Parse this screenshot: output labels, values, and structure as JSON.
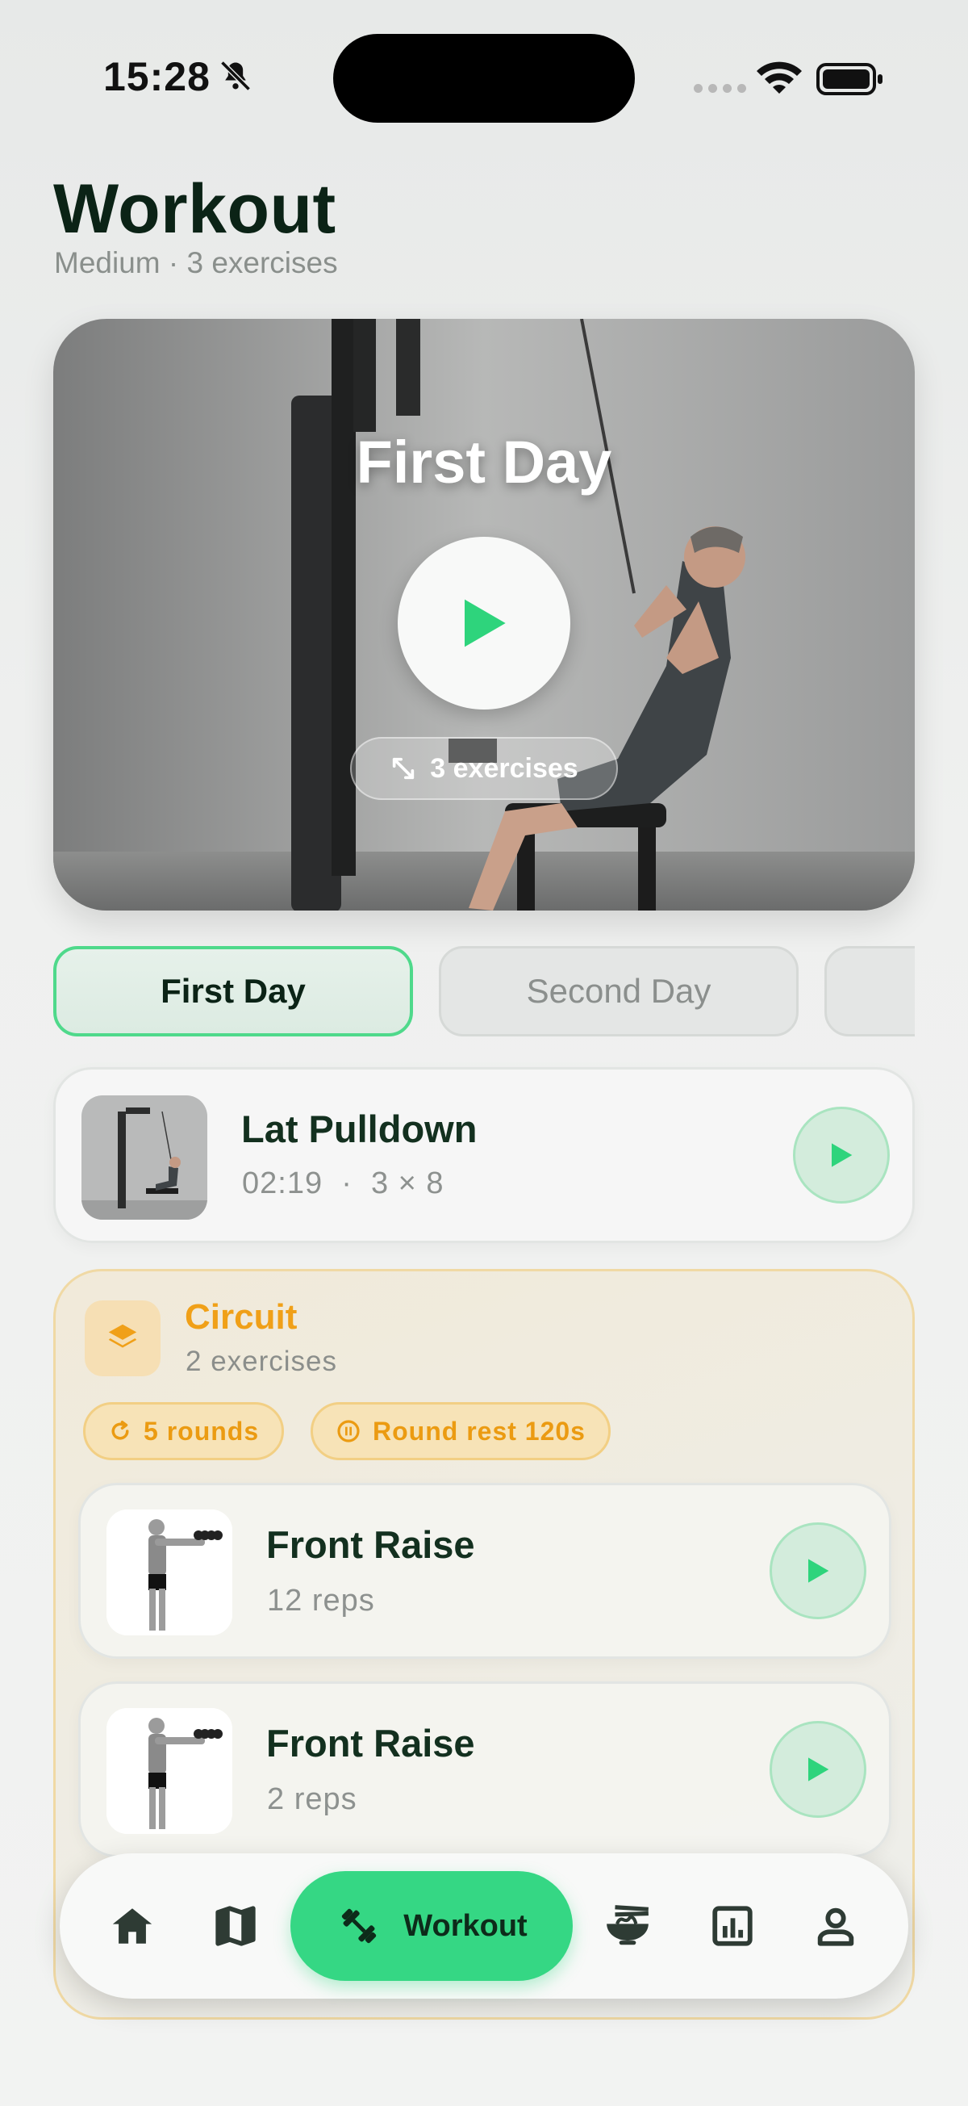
{
  "status_bar": {
    "time": "15:28"
  },
  "header": {
    "title": "Workout",
    "subtitle": "Medium · 3 exercises"
  },
  "hero": {
    "title": "First Day",
    "exercises_pill": "3 exercises"
  },
  "tabs": [
    {
      "label": "First Day",
      "active": true
    },
    {
      "label": "Second Day",
      "active": false
    },
    {
      "label": "",
      "active": false
    }
  ],
  "exercises": [
    {
      "name": "Lat Pulldown",
      "meta": "02:19  ·  3 × 8"
    }
  ],
  "circuit": {
    "title": "Circuit",
    "subtitle": "2 exercises",
    "rounds": "5 rounds",
    "rest": "Round rest 120s",
    "items": [
      {
        "name": "Front Raise",
        "meta": "12 reps"
      },
      {
        "name": "Front Raise",
        "meta": "2 reps"
      }
    ]
  },
  "nav": {
    "active_label": "Workout"
  },
  "colors": {
    "accent": "#35d784",
    "circuit_accent": "#f0a018",
    "title": "#0b2316"
  }
}
